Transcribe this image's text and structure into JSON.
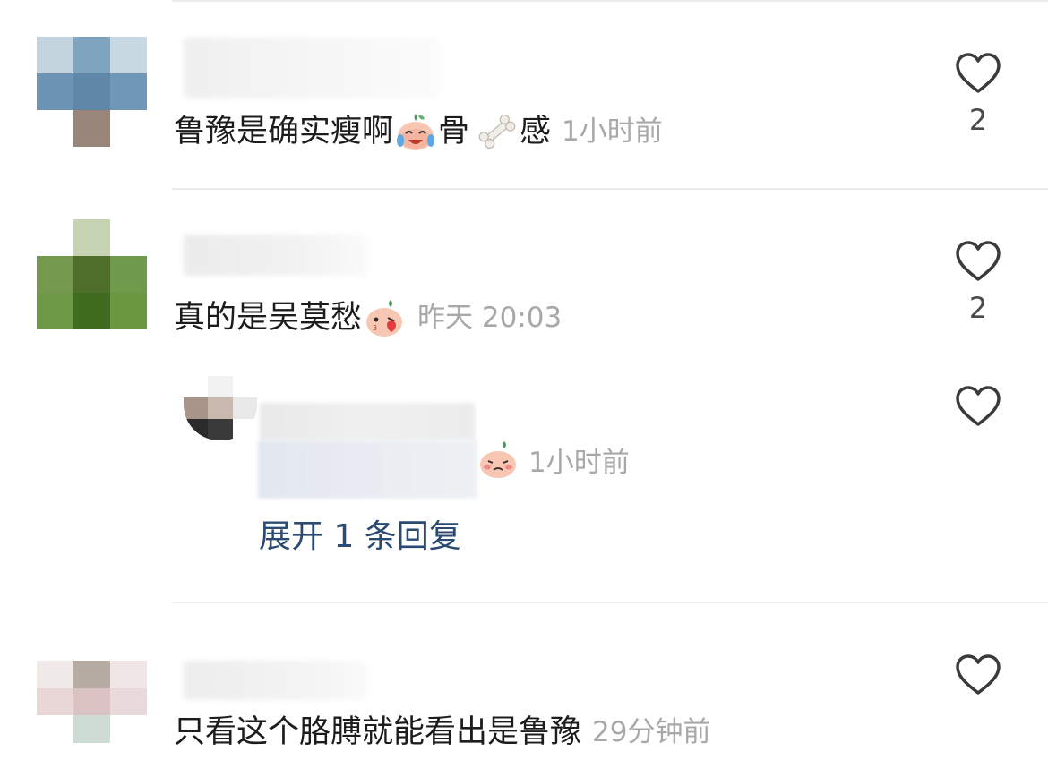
{
  "comments": [
    {
      "text_before": "鲁豫是确实瘦啊",
      "emoji_1": "crying-laughing-radish-emoji",
      "text_mid": "骨",
      "emoji_2": "bone-emoji",
      "text_after": "感",
      "time": "1小时前",
      "likes": "2"
    },
    {
      "text_before": "真的是吴莫愁",
      "emoji_1": "blushing-radish-emoji",
      "time": "昨天 20:03",
      "likes": "2"
    },
    {
      "text_before": "只看这个胳膊就能看出是鲁豫",
      "time": "29分钟前"
    }
  ],
  "reply": {
    "emoji": "shy-radish-emoji",
    "time": "1小时前",
    "expand_label": "展开 1 条回复"
  },
  "colors": {
    "link": "#2a4a72",
    "meta": "#a8a8a8",
    "divider": "#ececec"
  }
}
